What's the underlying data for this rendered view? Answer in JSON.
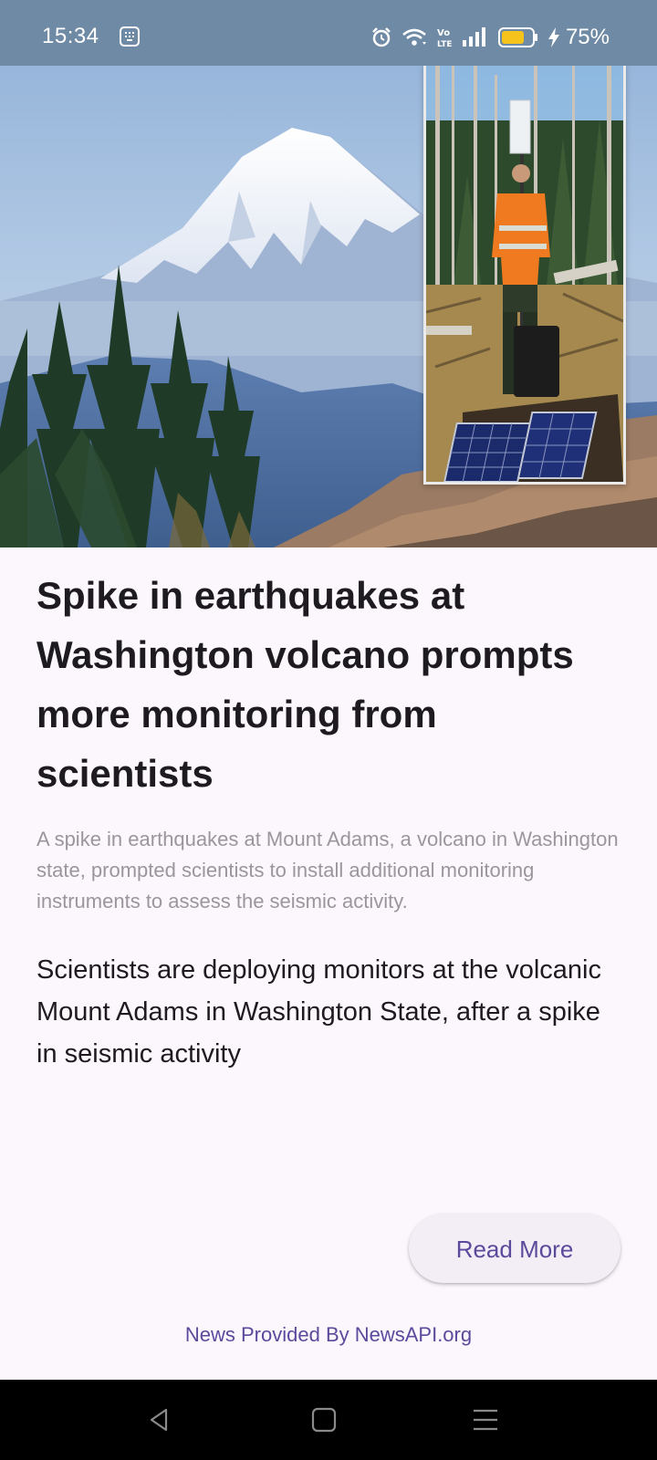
{
  "status_bar": {
    "time": "15:34",
    "battery_percent": "75%",
    "battery_level": 0.75,
    "icons": [
      "keyboard-icon",
      "alarm-icon",
      "wifi-icon",
      "volte-icon",
      "signal-icon",
      "battery-icon",
      "charging-icon"
    ]
  },
  "article": {
    "title": "Spike in earthquakes at Washington volcano prompts more monitoring from scientists",
    "description": "A spike in earthquakes at Mount Adams, a volcano in Washington state, prompted scientists to install additional monitoring instruments to assess the seismic activity.",
    "content": "Scientists are deploying monitors at the volcanic Mount Adams in Washington State, after a spike in seismic activity"
  },
  "read_more_label": "Read More",
  "provider_text": "News Provided By NewsAPI.org",
  "colors": {
    "accent": "#5a4a9c",
    "background": "#fcf6fd",
    "status_bar": "#6f8aa5",
    "button_bg": "#f3eef6",
    "title_text": "#1e1b20",
    "description_text": "#9a969c"
  },
  "nav_bar": {
    "icons": [
      "back-icon",
      "home-icon",
      "menu-icon"
    ]
  }
}
